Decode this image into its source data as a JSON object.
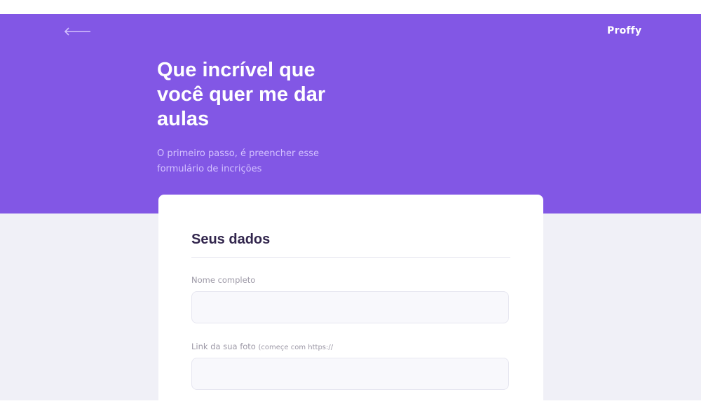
{
  "header": {
    "back_icon": "arrow-left-icon",
    "brand": "Proffy"
  },
  "hero": {
    "title": "Que incrível que você quer me dar aulas",
    "subtitle": "O primeiro passo, é preencher esse formulário de incrições"
  },
  "form": {
    "section_title": "Seus dados",
    "fields": [
      {
        "label": "Nome completo",
        "hint": "",
        "value": "",
        "placeholder": ""
      },
      {
        "label": "Link da sua foto",
        "hint": "(começe com https://",
        "value": "",
        "placeholder": ""
      }
    ]
  },
  "colors": {
    "primary": "#8257e5",
    "background": "#f0f0f7",
    "card": "#ffffff",
    "title": "#32264d",
    "label": "#9c98a6",
    "input_background": "#f8f8fc",
    "input_border": "#e6e6f0"
  }
}
